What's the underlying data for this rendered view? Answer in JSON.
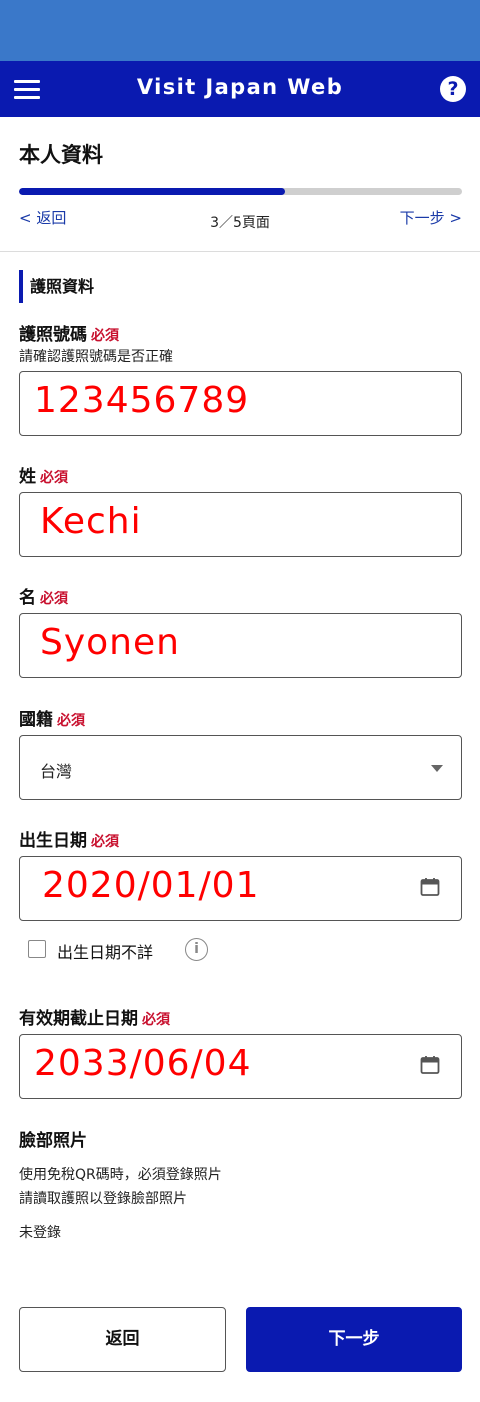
{
  "app": {
    "title": "Visit Japan Web",
    "help_glyph": "?",
    "brand_color": "#0a1ab0",
    "status_bar_color": "#3a78c9"
  },
  "page": {
    "title": "本人資料",
    "progress": {
      "current": 3,
      "total": 5,
      "fraction": 0.6
    }
  },
  "nav": {
    "back_label": "< 返回",
    "next_label": "下一步 >",
    "page_indicator": "3／5頁面"
  },
  "section": {
    "title": "護照資料"
  },
  "required_label": "必須",
  "fields": {
    "passport_number": {
      "label": "護照號碼",
      "hint": "請確認護照號碼是否正確",
      "value": "123456789"
    },
    "surname": {
      "label": "姓",
      "value": "Kechi"
    },
    "given_name": {
      "label": "名",
      "value": "Syonen"
    },
    "nationality": {
      "label": "國籍",
      "value": "台灣"
    },
    "birth_date": {
      "label": "出生日期",
      "value": "2020/01/01"
    },
    "birth_unknown": {
      "label": "出生日期不詳",
      "checked": false
    },
    "expiry_date": {
      "label": "有效期截止日期",
      "value": "2033/06/04"
    }
  },
  "photo": {
    "title": "臉部照片",
    "line1": "使用免稅QR碼時，必須登錄照片",
    "line2": "請讀取護照以登錄臉部照片",
    "status": "未登錄"
  },
  "buttons": {
    "back": "返回",
    "next": "下一步"
  },
  "icons": {
    "menu": "menu-icon",
    "help": "help-icon",
    "calendar": "calendar-icon",
    "info": "info-icon",
    "dropdown": "chevron-down-icon"
  }
}
